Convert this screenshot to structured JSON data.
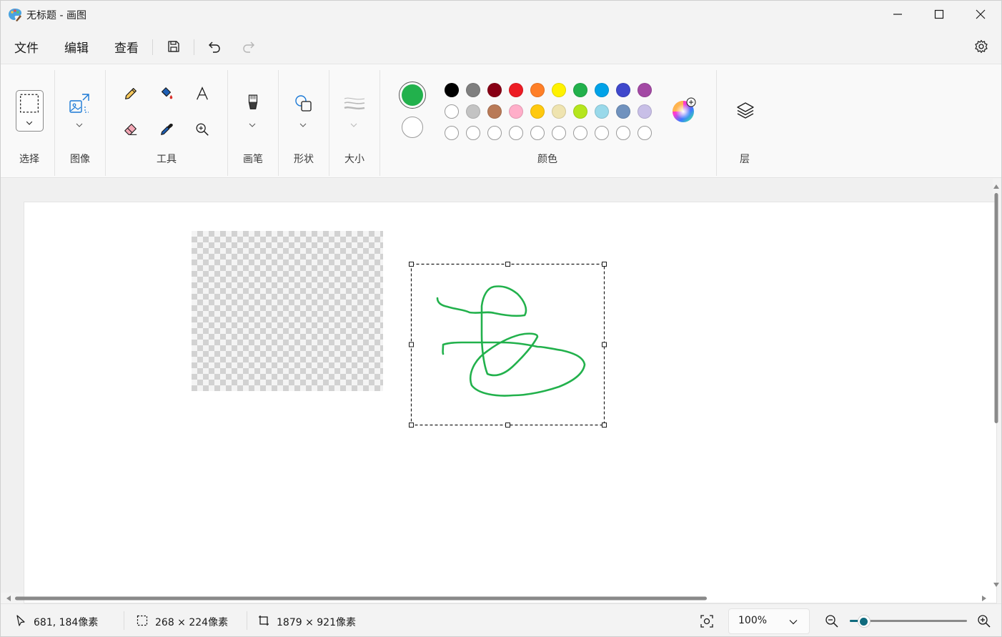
{
  "window": {
    "title": "无标题 - 画图"
  },
  "menu": {
    "file": "文件",
    "edit": "编辑",
    "view": "查看"
  },
  "ribbon": {
    "groups": {
      "select": "选择",
      "image": "图像",
      "tools": "工具",
      "brush": "画笔",
      "shapes": "形状",
      "size": "大小",
      "colors": "颜色",
      "layers": "层"
    },
    "primary_color": "#22b14c",
    "secondary_color": "#ffffff",
    "palette_row1": [
      "#000000",
      "#7f7f7f",
      "#880015",
      "#ed1c24",
      "#ff7f27",
      "#fff200",
      "#22b14c",
      "#00a2e8",
      "#3f48cc",
      "#a349a4"
    ],
    "palette_row2": [
      "#ffffff",
      "#c3c3c3",
      "#b97a57",
      "#ffaec9",
      "#ffc90e",
      "#efe4b0",
      "#b5e61d",
      "#99d9ea",
      "#7092be",
      "#c8bfe7"
    ]
  },
  "status": {
    "cursor_pos": "681, 184像素",
    "selection_size": "268 × 224像素",
    "canvas_size": "1879 × 921像素",
    "zoom": "100%",
    "zoom_slider_fraction": 0.12
  }
}
